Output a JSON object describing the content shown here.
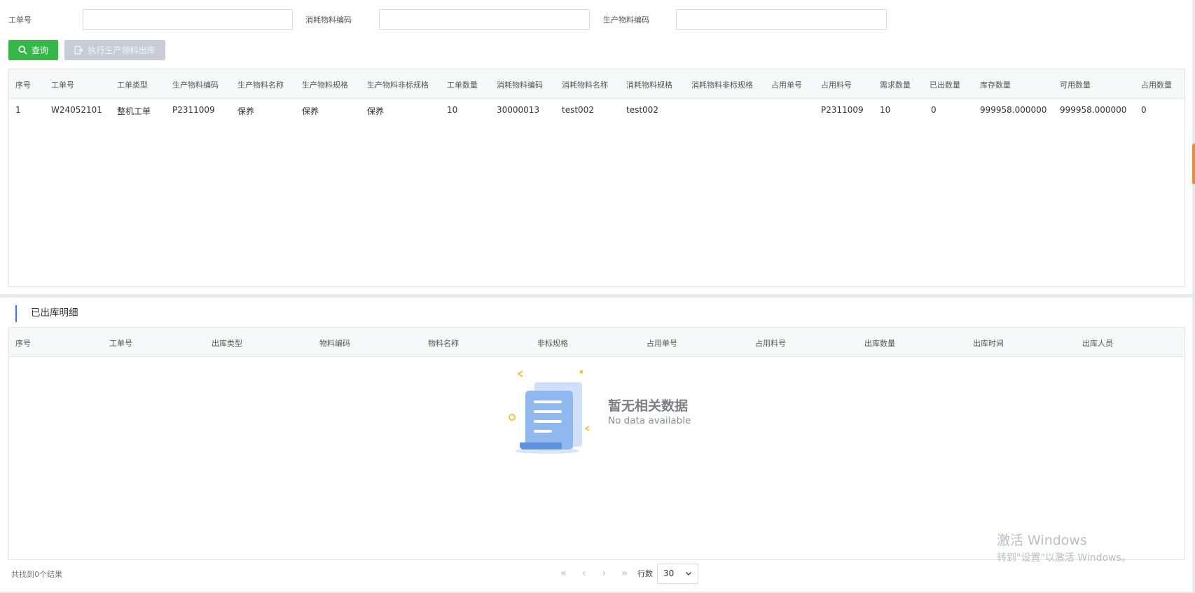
{
  "filters": {
    "work_order_label": "工单号",
    "consume_code_label": "消耗物料编码",
    "produce_code_label": "生产物料编码",
    "work_order_value": "",
    "consume_code_value": "",
    "produce_code_value": ""
  },
  "toolbar": {
    "query_label": "查询",
    "execute_label": "执行生产领料出库"
  },
  "main_table": {
    "headers": [
      "序号",
      "工单号",
      "工单类型",
      "生产物料编码",
      "生产物料名称",
      "生产物料规格",
      "生产物料非标规格",
      "工单数量",
      "消耗物料编码",
      "消耗物料名称",
      "消耗物料规格",
      "消耗物料非标规格",
      "占用单号",
      "占用料号",
      "需求数量",
      "已出数量",
      "库存数量",
      "可用数量",
      "占用数量"
    ],
    "rows": [
      [
        "1",
        "W24052101",
        "整机工单",
        "P2311009",
        "保养",
        "保养",
        "保养",
        "10",
        "30000013",
        "test002",
        "test002",
        "",
        "",
        "P2311009",
        "10",
        "0",
        "999958.000000",
        "999958.000000",
        "0"
      ]
    ]
  },
  "detail_section": {
    "title": "已出库明细",
    "headers": [
      "序号",
      "工单号",
      "出库类型",
      "物料编码",
      "物料名称",
      "非标规格",
      "占用单号",
      "占用料号",
      "出库数量",
      "出库时间",
      "出库人员"
    ],
    "empty_title": "暂无相关数据",
    "empty_subtitle": "No data available"
  },
  "footer": {
    "result_count": "共找到0个结果",
    "rows_label": "行数",
    "rows_value": "30"
  },
  "watermark": {
    "title": "激活 Windows",
    "subtitle": "转到\"设置\"以激活 Windows。"
  },
  "colors": {
    "query_button": "#36b849",
    "disabled_button": "#c7ccd6",
    "accent": "#2f7bf5",
    "side_tab": "#f18a3b"
  }
}
